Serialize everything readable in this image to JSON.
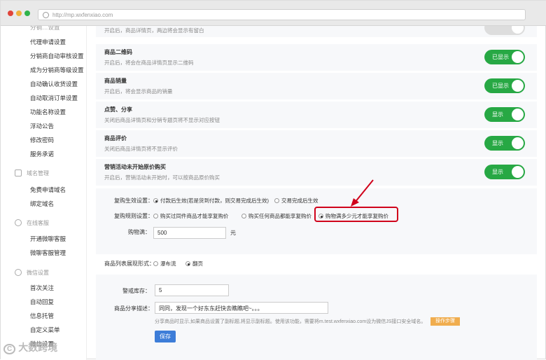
{
  "browser": {
    "url": "http://mp.wxfenxiao.com",
    "colors": {
      "close": "#e0443a",
      "min": "#f0b23b",
      "max": "#2fb34a"
    }
  },
  "sidebar": {
    "top_partial": "分销…设置",
    "group1": [
      "代理申请设置",
      "分销商自动审核设置",
      "成为分销商等级设置",
      "自动确认收货设置",
      "自动取消订单设置",
      "功能名称设置",
      "浮动公告",
      "修改密码",
      "服务承诺"
    ],
    "domain_head": "域名管理",
    "domain_items": [
      "免费申请域名",
      "绑定域名"
    ],
    "service_head": "在线客服",
    "service_items": [
      "开通微聊客服",
      "微聊客服管理"
    ],
    "wechat_head": "微信设置",
    "wechat_items": [
      "首次关注",
      "自动回复",
      "信息托管",
      "自定义菜单",
      "微信设置"
    ]
  },
  "settings": {
    "top_desc": "开启后，商品详情页，两边将会显示有留白",
    "rows": [
      {
        "title": "商品二维码",
        "desc": "开启后，将会在商品详情页显示二维码",
        "toggle": "已显示"
      },
      {
        "title": "商品销量",
        "desc": "开启后，将会显示商品的销量",
        "toggle": "已显示"
      },
      {
        "title": "点赞、分享",
        "desc": "关闭后商品详情页和分销专题页将不显示对应按钮",
        "toggle": "显示"
      },
      {
        "title": "商品评价",
        "desc": "关闭后商品详情页将不显示评价",
        "toggle": "显示"
      },
      {
        "title": "营销活动未开始原价购买",
        "desc": "开启后，营销活动未开始时，可以按商品原价购买",
        "toggle": "显示"
      }
    ]
  },
  "repurchase": {
    "effective_label": "复购生效设置：",
    "effective_opts": [
      "付款后生效(若是货到付款，则交易完成后生效)",
      "交易完成后生效"
    ],
    "rule_label": "复购规则设置：",
    "rule_opts": [
      "购买过同件商品才能享复购价",
      "购买任何商品都能享复购价",
      "购物满多少元才能享复购价"
    ],
    "amount_label": "购物满：",
    "amount_value": "500",
    "amount_unit": "元"
  },
  "list_display": {
    "label": "商品列表展现形式：",
    "opts": [
      "瀑布流",
      "翻页"
    ]
  },
  "stock": {
    "label": "警戒库存：",
    "value": "5"
  },
  "share": {
    "label": "商品分享描述：",
    "value": "同同，发现一个好东东赶快去瞧瞧吧~。。。",
    "note": "分享商品时显示,如果商品设置了副标题,将显示副标题。使用该功能，需要将m.test.wxfenxiao.com设为微信JS接口安全域名。",
    "btn": "操作步骤"
  },
  "save_label": "保存",
  "watermark": "大数跨境"
}
